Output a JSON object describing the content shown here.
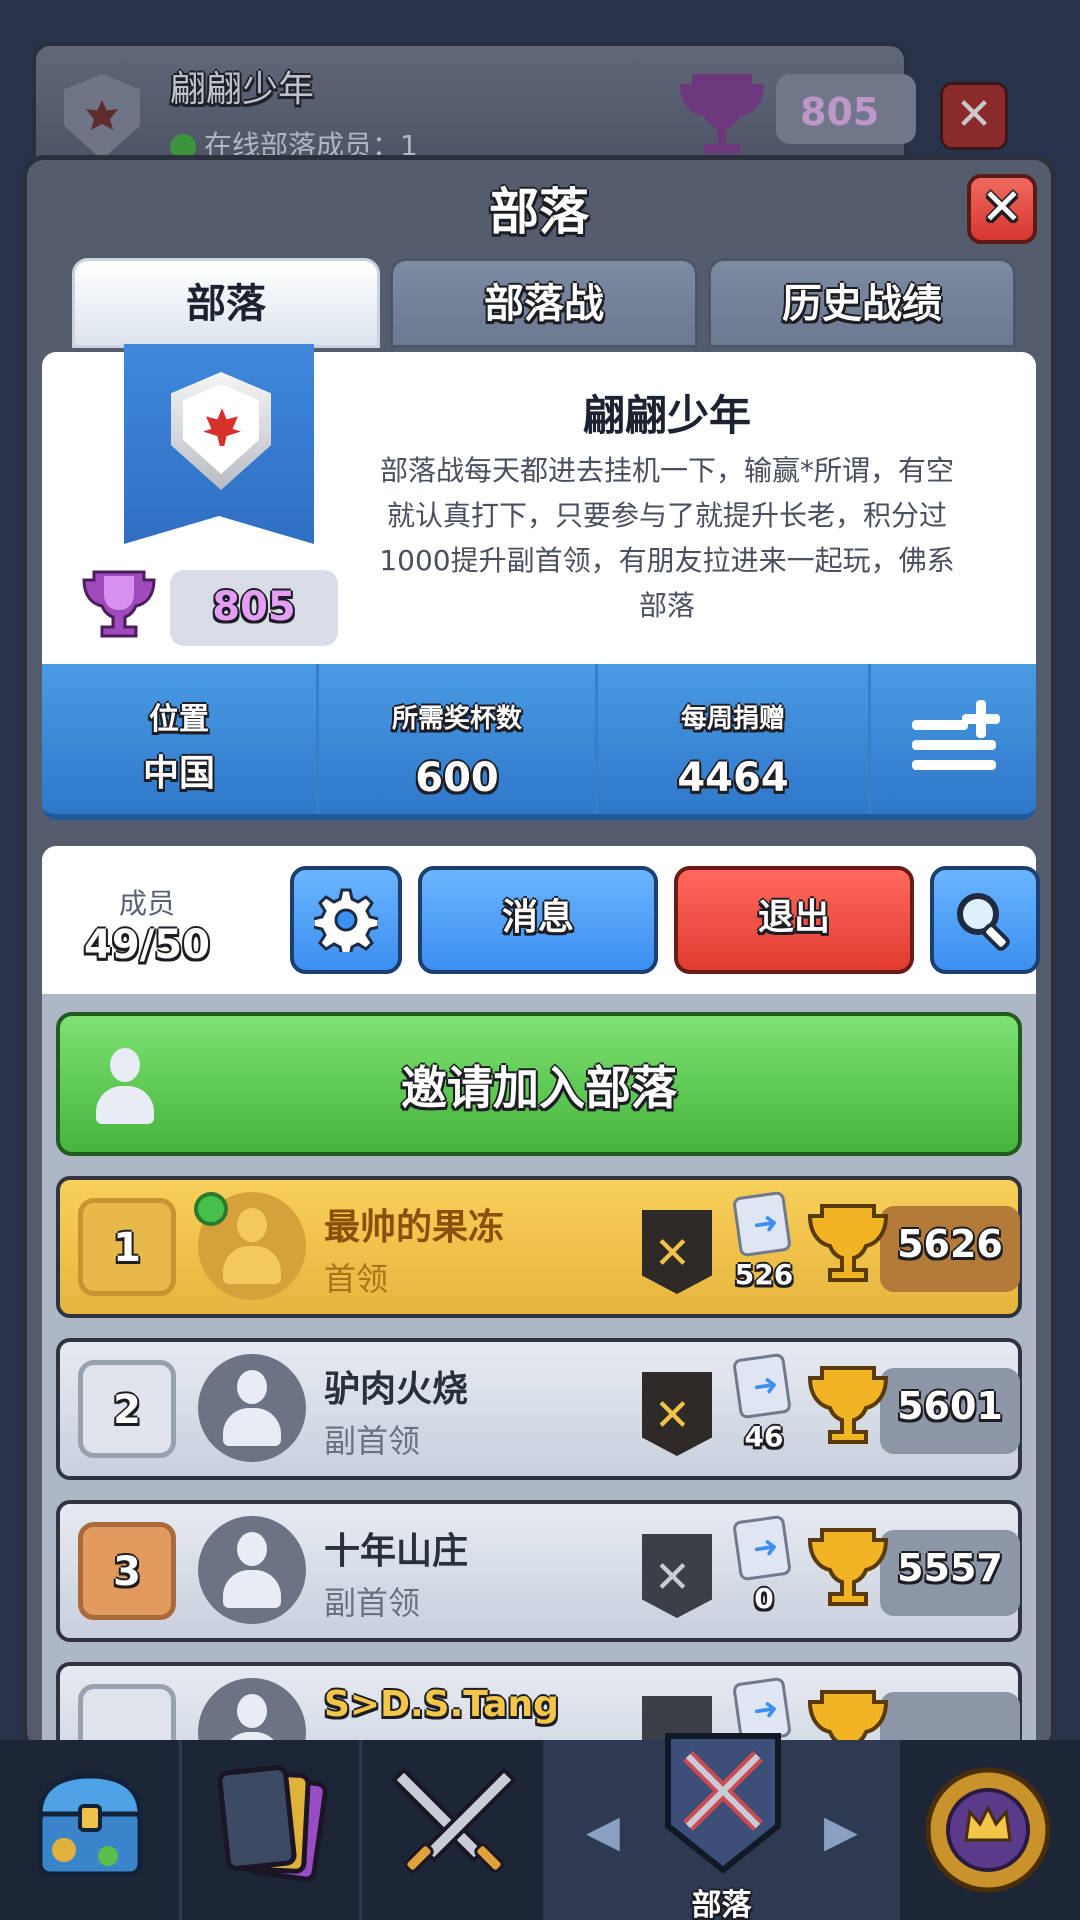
{
  "background_window": {
    "clan_name": "翩翩少年",
    "online_text": "在线部落成员：1",
    "trophies": "805"
  },
  "panel": {
    "title": "部落",
    "close_glyph": "✕"
  },
  "tabs": [
    {
      "label": "部落",
      "active": true
    },
    {
      "label": "部落战",
      "active": false
    },
    {
      "label": "历史战绩",
      "active": false
    }
  ],
  "clan": {
    "name": "翩翩少年",
    "description": "部落战每天都进去挂机一下，输赢*所谓，有空就认真打下，只要参与了就提升长老，积分过1000提升副首领，有朋友拉进来一起玩，佛系部落",
    "trophies": "805"
  },
  "stats": {
    "location_label": "位置",
    "location_value": "中国",
    "required_label": "所需奖杯数",
    "required_value": "600",
    "donations_label": "每周捐赠",
    "donations_value": "4464"
  },
  "members": {
    "label": "成员",
    "count": "49/50",
    "message_button": "消息",
    "leave_button": "退出"
  },
  "invite_button": "邀请加入部落",
  "member_list": [
    {
      "rank": "1",
      "name": "最帅的果冻",
      "role": "首领",
      "donations": "526",
      "trophies": "5626",
      "online": true
    },
    {
      "rank": "2",
      "name": "驴肉火烧",
      "role": "副首领",
      "donations": "46",
      "trophies": "5601",
      "online": false
    },
    {
      "rank": "3",
      "name": "十年山庄",
      "role": "副首领",
      "donations": "0",
      "trophies": "5557",
      "online": false
    },
    {
      "rank": "4",
      "name": "S>D.S.Tang",
      "role": "",
      "donations": "",
      "trophies": "",
      "online": false
    }
  ],
  "bottom_nav": {
    "active_label": "部落",
    "left_arrow": "◀",
    "right_arrow": "▶"
  },
  "colors": {
    "gold_row": "#e7b53d",
    "invite_green": "#46b43c",
    "leave_red": "#e03c30",
    "stats_blue": "#2f78c8",
    "trophy_purple": "#e49ff5"
  }
}
